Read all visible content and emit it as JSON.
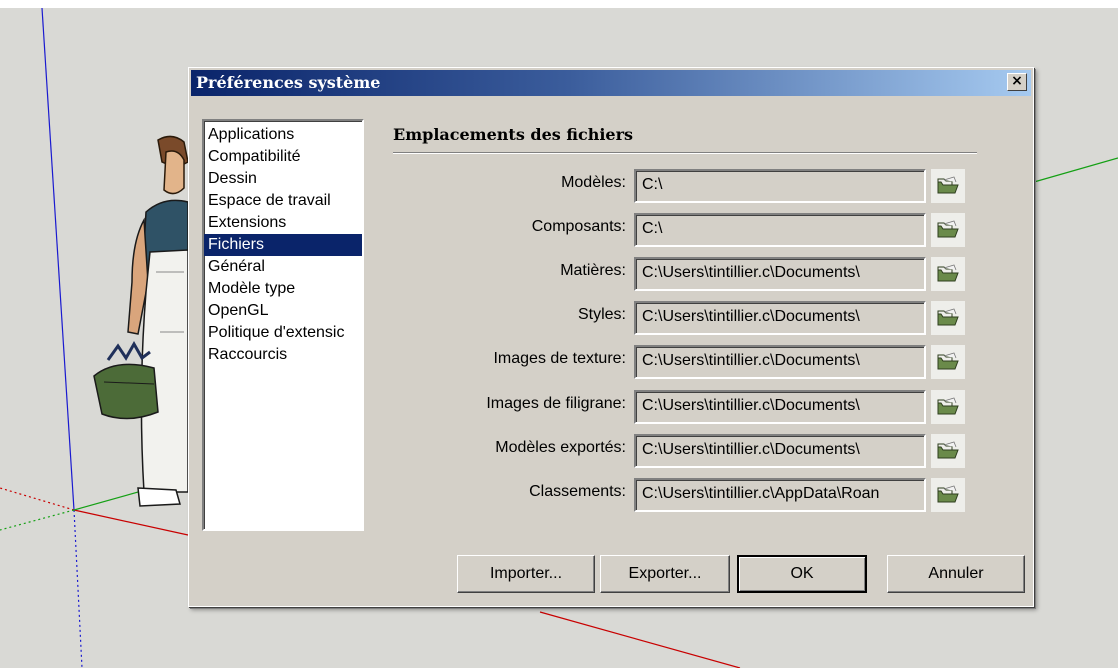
{
  "dialog": {
    "title": "Préférences système",
    "close_label": "×"
  },
  "categories": [
    {
      "label": "Applications",
      "selected": false
    },
    {
      "label": "Compatibilité",
      "selected": false
    },
    {
      "label": "Dessin",
      "selected": false
    },
    {
      "label": "Espace de travail",
      "selected": false
    },
    {
      "label": "Extensions",
      "selected": false
    },
    {
      "label": "Fichiers",
      "selected": true
    },
    {
      "label": "Général",
      "selected": false
    },
    {
      "label": "Modèle type",
      "selected": false
    },
    {
      "label": "OpenGL",
      "selected": false
    },
    {
      "label": "Politique d'extensic",
      "selected": false
    },
    {
      "label": "Raccourcis",
      "selected": false
    }
  ],
  "section": {
    "title": "Emplacements des fichiers"
  },
  "file_rows": [
    {
      "label": "Modèles:",
      "value": "C:\\",
      "icon": "folder-open-icon"
    },
    {
      "label": "Composants:",
      "value": "C:\\",
      "icon": "folder-open-icon"
    },
    {
      "label": "Matières:",
      "value": "C:\\Users\\tintillier.c\\Documents\\",
      "icon": "folder-open-icon"
    },
    {
      "label": "Styles:",
      "value": "C:\\Users\\tintillier.c\\Documents\\",
      "icon": "folder-open-icon"
    },
    {
      "label": "Images de texture:",
      "value": "C:\\Users\\tintillier.c\\Documents\\",
      "icon": "folder-open-icon"
    },
    {
      "label": "Images de filigrane:",
      "value": "C:\\Users\\tintillier.c\\Documents\\",
      "icon": "folder-open-icon"
    },
    {
      "label": "Modèles exportés:",
      "value": "C:\\Users\\tintillier.c\\Documents\\",
      "icon": "folder-open-icon"
    },
    {
      "label": "Classements:",
      "value": "C:\\Users\\tintillier.c\\AppData\\Roan",
      "icon": "folder-open-icon"
    }
  ],
  "buttons": {
    "import_label": "Importer...",
    "export_label": "Exporter...",
    "ok_label": "OK",
    "cancel_label": "Annuler"
  },
  "colors": {
    "title_bar_start": "#0a246a",
    "title_bar_end": "#a6caf0",
    "selection": "#0a246a",
    "dialog_face": "#d4d0c8",
    "axis_red": "#cc0000",
    "axis_green": "#00aa00",
    "axis_blue": "#0000cc"
  }
}
